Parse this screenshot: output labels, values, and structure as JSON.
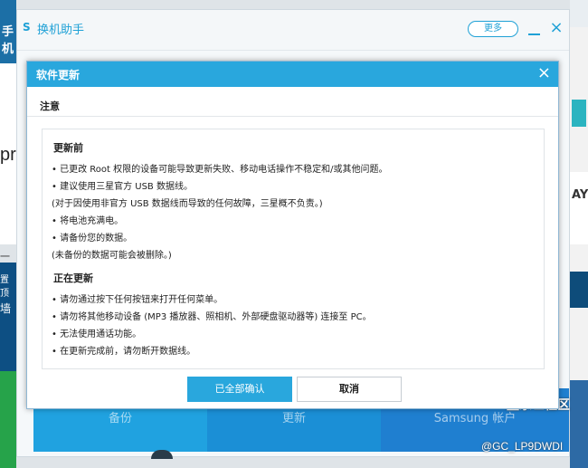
{
  "background": {
    "left_top": "手机",
    "left_white_word": "pr",
    "left_white_small": "一",
    "left_dark_top": "置顶",
    "left_dark_bottom": "墙",
    "right_letter": "AY"
  },
  "app": {
    "logo": "S",
    "title": "换机助手",
    "more_label": "更多",
    "close_icon": "×",
    "tiles": [
      "备份",
      "更新",
      "Samsung 帐户"
    ]
  },
  "dialog": {
    "title": "软件更新",
    "close_icon": "×",
    "notice": "注意",
    "section1_title": "更新前",
    "section1_lines": [
      "• 已更改 Root 权限的设备可能导致更新失败、移动电话操作不稳定和/或其他问题。",
      "• 建议使用三星官方 USB 数据线。",
      "(对于因使用非官方 USB 数据线而导致的任何故障，三星概不负责。)",
      "• 将电池充满电。",
      "• 请备份您的数据。",
      "(未备份的数据可能会被删除。)"
    ],
    "section2_title": "正在更新",
    "section2_lines": [
      "• 请勿通过按下任何按钮来打开任何菜单。",
      "• 请勿将其他移动设备 (MP3 播放器、照相机、外部硬盘驱动器等) 连接至 PC。",
      "• 无法使用通话功能。",
      "• 在更新完成前，请勿断开数据线。"
    ],
    "confirm_label": "已全部确认",
    "cancel_label": "取消"
  },
  "watermark": {
    "line1": "盖乐世社区",
    "line2": "@GC_LP9DWDI"
  },
  "colors": {
    "accent": "#29a7dd",
    "app_accent": "#1fa1d6"
  }
}
